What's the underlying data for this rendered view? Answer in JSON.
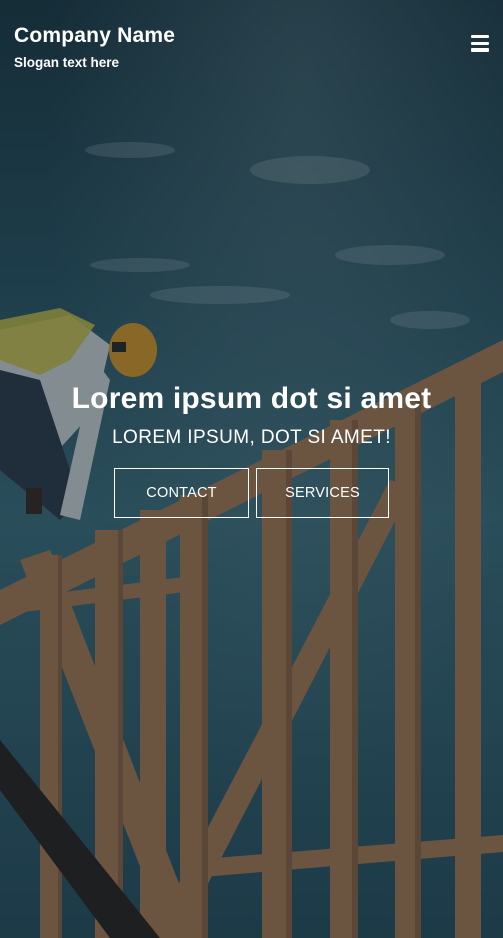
{
  "header": {
    "company_name": "Company Name",
    "slogan": "Slogan text here",
    "menu_icon": "hamburger-menu-icon"
  },
  "hero": {
    "title": "Lorem ipsum dot si amet",
    "subtitle": "LOREM IPSUM, DOT SI AMET!",
    "buttons": {
      "contact_label": "CONTACT",
      "services_label": "SERVICES"
    }
  },
  "colors": {
    "text": "#ffffff",
    "overlay": "#0f2230",
    "sky": "#3f6f7d",
    "wood": "#b98a62",
    "helmet": "#d89a2b",
    "vest": "#c9c04a"
  }
}
